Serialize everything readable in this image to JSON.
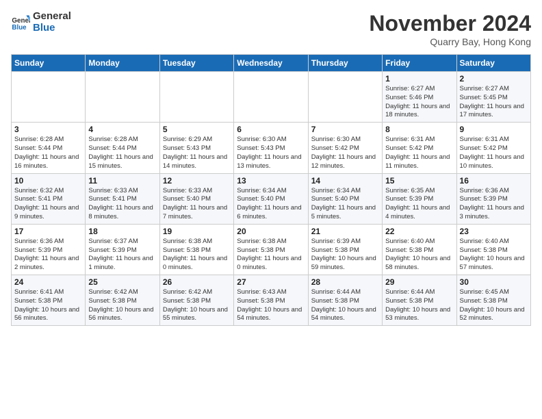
{
  "header": {
    "logo_line1": "General",
    "logo_line2": "Blue",
    "month": "November 2024",
    "location": "Quarry Bay, Hong Kong"
  },
  "weekdays": [
    "Sunday",
    "Monday",
    "Tuesday",
    "Wednesday",
    "Thursday",
    "Friday",
    "Saturday"
  ],
  "weeks": [
    [
      {
        "day": "",
        "info": ""
      },
      {
        "day": "",
        "info": ""
      },
      {
        "day": "",
        "info": ""
      },
      {
        "day": "",
        "info": ""
      },
      {
        "day": "",
        "info": ""
      },
      {
        "day": "1",
        "info": "Sunrise: 6:27 AM\nSunset: 5:46 PM\nDaylight: 11 hours and 18 minutes."
      },
      {
        "day": "2",
        "info": "Sunrise: 6:27 AM\nSunset: 5:45 PM\nDaylight: 11 hours and 17 minutes."
      }
    ],
    [
      {
        "day": "3",
        "info": "Sunrise: 6:28 AM\nSunset: 5:44 PM\nDaylight: 11 hours and 16 minutes."
      },
      {
        "day": "4",
        "info": "Sunrise: 6:28 AM\nSunset: 5:44 PM\nDaylight: 11 hours and 15 minutes."
      },
      {
        "day": "5",
        "info": "Sunrise: 6:29 AM\nSunset: 5:43 PM\nDaylight: 11 hours and 14 minutes."
      },
      {
        "day": "6",
        "info": "Sunrise: 6:30 AM\nSunset: 5:43 PM\nDaylight: 11 hours and 13 minutes."
      },
      {
        "day": "7",
        "info": "Sunrise: 6:30 AM\nSunset: 5:42 PM\nDaylight: 11 hours and 12 minutes."
      },
      {
        "day": "8",
        "info": "Sunrise: 6:31 AM\nSunset: 5:42 PM\nDaylight: 11 hours and 11 minutes."
      },
      {
        "day": "9",
        "info": "Sunrise: 6:31 AM\nSunset: 5:42 PM\nDaylight: 11 hours and 10 minutes."
      }
    ],
    [
      {
        "day": "10",
        "info": "Sunrise: 6:32 AM\nSunset: 5:41 PM\nDaylight: 11 hours and 9 minutes."
      },
      {
        "day": "11",
        "info": "Sunrise: 6:33 AM\nSunset: 5:41 PM\nDaylight: 11 hours and 8 minutes."
      },
      {
        "day": "12",
        "info": "Sunrise: 6:33 AM\nSunset: 5:40 PM\nDaylight: 11 hours and 7 minutes."
      },
      {
        "day": "13",
        "info": "Sunrise: 6:34 AM\nSunset: 5:40 PM\nDaylight: 11 hours and 6 minutes."
      },
      {
        "day": "14",
        "info": "Sunrise: 6:34 AM\nSunset: 5:40 PM\nDaylight: 11 hours and 5 minutes."
      },
      {
        "day": "15",
        "info": "Sunrise: 6:35 AM\nSunset: 5:39 PM\nDaylight: 11 hours and 4 minutes."
      },
      {
        "day": "16",
        "info": "Sunrise: 6:36 AM\nSunset: 5:39 PM\nDaylight: 11 hours and 3 minutes."
      }
    ],
    [
      {
        "day": "17",
        "info": "Sunrise: 6:36 AM\nSunset: 5:39 PM\nDaylight: 11 hours and 2 minutes."
      },
      {
        "day": "18",
        "info": "Sunrise: 6:37 AM\nSunset: 5:39 PM\nDaylight: 11 hours and 1 minute."
      },
      {
        "day": "19",
        "info": "Sunrise: 6:38 AM\nSunset: 5:38 PM\nDaylight: 11 hours and 0 minutes."
      },
      {
        "day": "20",
        "info": "Sunrise: 6:38 AM\nSunset: 5:38 PM\nDaylight: 11 hours and 0 minutes."
      },
      {
        "day": "21",
        "info": "Sunrise: 6:39 AM\nSunset: 5:38 PM\nDaylight: 10 hours and 59 minutes."
      },
      {
        "day": "22",
        "info": "Sunrise: 6:40 AM\nSunset: 5:38 PM\nDaylight: 10 hours and 58 minutes."
      },
      {
        "day": "23",
        "info": "Sunrise: 6:40 AM\nSunset: 5:38 PM\nDaylight: 10 hours and 57 minutes."
      }
    ],
    [
      {
        "day": "24",
        "info": "Sunrise: 6:41 AM\nSunset: 5:38 PM\nDaylight: 10 hours and 56 minutes."
      },
      {
        "day": "25",
        "info": "Sunrise: 6:42 AM\nSunset: 5:38 PM\nDaylight: 10 hours and 56 minutes."
      },
      {
        "day": "26",
        "info": "Sunrise: 6:42 AM\nSunset: 5:38 PM\nDaylight: 10 hours and 55 minutes."
      },
      {
        "day": "27",
        "info": "Sunrise: 6:43 AM\nSunset: 5:38 PM\nDaylight: 10 hours and 54 minutes."
      },
      {
        "day": "28",
        "info": "Sunrise: 6:44 AM\nSunset: 5:38 PM\nDaylight: 10 hours and 54 minutes."
      },
      {
        "day": "29",
        "info": "Sunrise: 6:44 AM\nSunset: 5:38 PM\nDaylight: 10 hours and 53 minutes."
      },
      {
        "day": "30",
        "info": "Sunrise: 6:45 AM\nSunset: 5:38 PM\nDaylight: 10 hours and 52 minutes."
      }
    ]
  ]
}
